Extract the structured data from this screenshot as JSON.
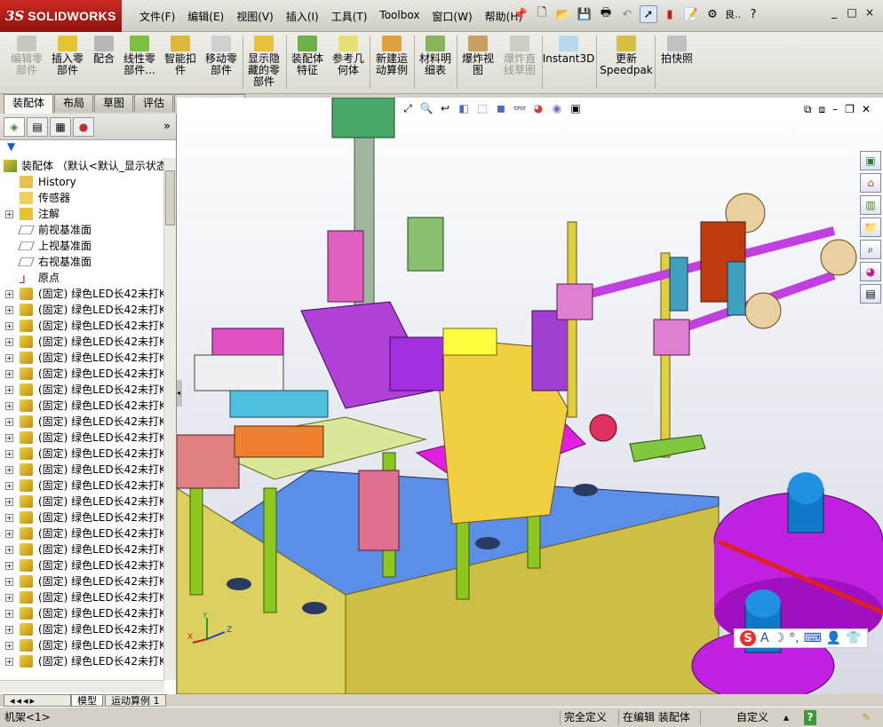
{
  "app": {
    "brand_ds": "3S",
    "brand_name": "SOLIDWORKS",
    "menus": [
      "文件(F)",
      "编辑(E)",
      "视图(V)",
      "插入(I)",
      "工具(T)",
      "Toolbox",
      "窗口(W)",
      "帮助(H)"
    ],
    "title_tools": [
      "new-document",
      "open",
      "save",
      "print",
      "undo",
      "select-pointer",
      "rebuild",
      "file-properties",
      "options"
    ],
    "title_truncated": "良..",
    "help_label": "?",
    "window_buttons": [
      "_",
      "□",
      "×"
    ]
  },
  "command_manager": {
    "buttons": [
      {
        "label": "编辑零\n部件",
        "enabled": false
      },
      {
        "label": "插入零\n部件",
        "enabled": true
      },
      {
        "label": "配合",
        "enabled": true
      },
      {
        "label": "线性零\n部件...",
        "enabled": true
      },
      {
        "label": "智能扣\n件",
        "enabled": true
      },
      {
        "label": "移动零\n部件",
        "enabled": true
      },
      {
        "label": "显示隐\n藏的零\n部件",
        "enabled": true
      },
      {
        "label": "装配体\n特征",
        "enabled": true
      },
      {
        "label": "参考几\n何体",
        "enabled": true
      },
      {
        "label": "新建运\n动算例",
        "enabled": true
      },
      {
        "label": "材料明\n细表",
        "enabled": true
      },
      {
        "label": "爆炸视\n图",
        "enabled": true
      },
      {
        "label": "爆炸直\n线草图",
        "enabled": false
      },
      {
        "label": "Instant3D",
        "enabled": true
      },
      {
        "label": "更新\nSpeedpak",
        "enabled": true
      },
      {
        "label": "拍快照",
        "enabled": true
      }
    ]
  },
  "tabs": [
    "装配体",
    "布局",
    "草图",
    "评估",
    "办公室产品"
  ],
  "active_tab": "装配体",
  "feature_tree": {
    "root": "装配体 （默认<默认_显示状态",
    "items": [
      {
        "label": "History",
        "icon": "history-folder-icon",
        "expandable": false
      },
      {
        "label": "传感器",
        "icon": "sensor-icon",
        "expandable": false
      },
      {
        "label": "注解",
        "icon": "annotation-icon",
        "expandable": true
      },
      {
        "label": "前视基准面",
        "icon": "plane-icon",
        "expandable": false
      },
      {
        "label": "上视基准面",
        "icon": "plane-icon",
        "expandable": false
      },
      {
        "label": "右视基准面",
        "icon": "plane-icon",
        "expandable": false
      },
      {
        "label": "原点",
        "icon": "origin-icon",
        "expandable": false
      }
    ],
    "component_label": "(固定) 绿色LED长42未打K",
    "component_count": 24
  },
  "bottom_tabs": [
    "模型",
    "运动算例 1"
  ],
  "statusbar": {
    "left": "机架<1>",
    "status1": "完全定义",
    "status2": "在编辑 装配体",
    "units": "自定义"
  },
  "viewport": {
    "heads_up_tools": [
      "zoom-to-fit",
      "zoom-area",
      "previous-view",
      "section-view",
      "view-orientation",
      "display-style",
      "hide-show",
      "edit-appearance",
      "apply-scene",
      "view-settings"
    ],
    "task_pane": [
      "resources-icon",
      "home-icon",
      "design-library-icon",
      "file-explorer-icon",
      "search-icon",
      "appearances-icon",
      "custom-properties-icon"
    ],
    "ime": {
      "logo": "S",
      "mode": "A"
    },
    "triad_axes": [
      "X",
      "Y",
      "Z"
    ]
  },
  "colors": {
    "brand_red": "#c1201a",
    "base_blue": "#5a8ee8",
    "cabinet": "#cdbf45",
    "magenta": "#e21ee0",
    "purple": "#a41ee6",
    "green_rod": "#9ad31e"
  }
}
